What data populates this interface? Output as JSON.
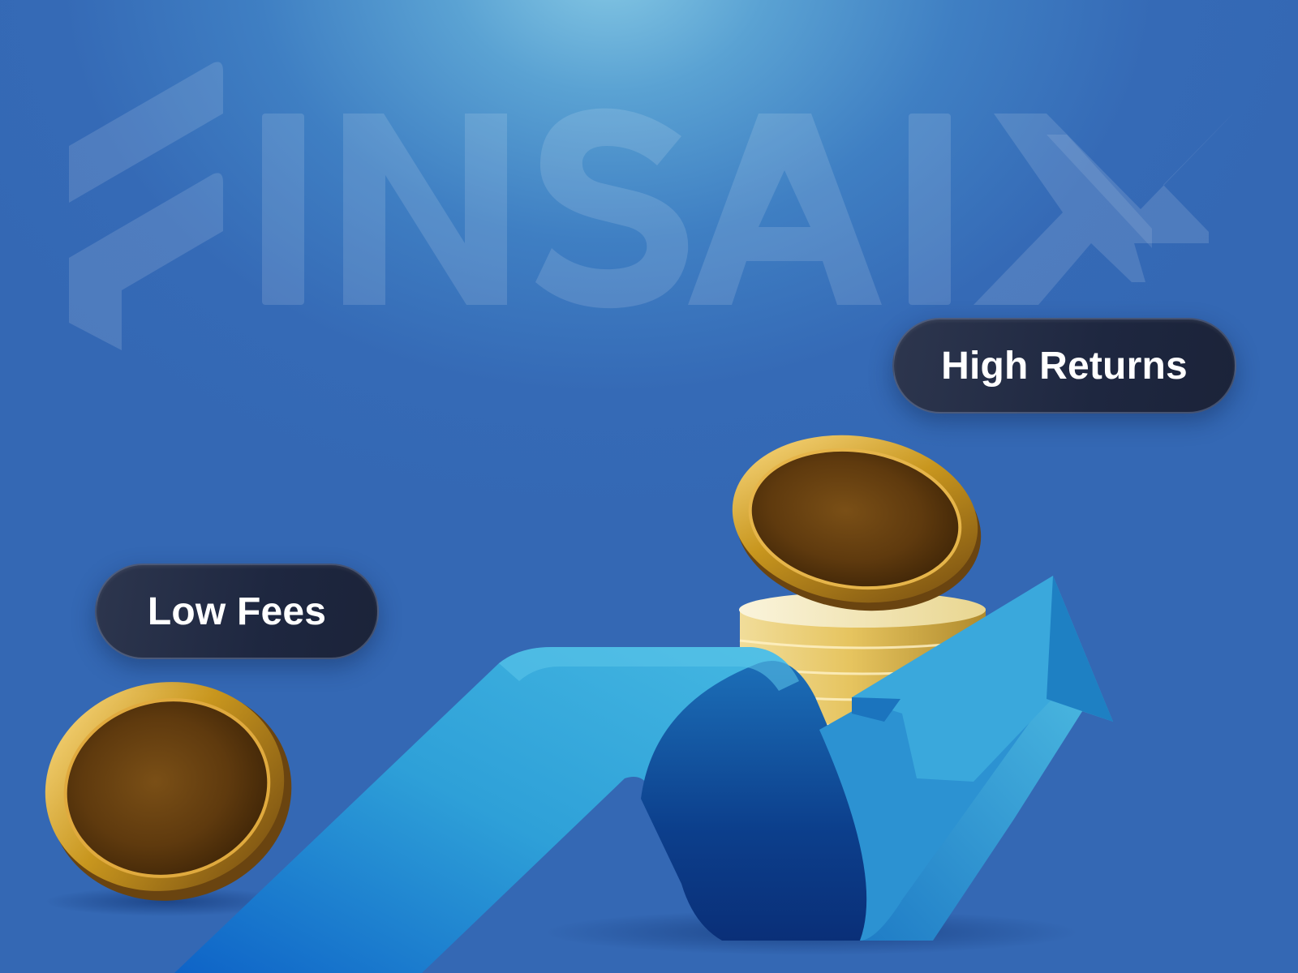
{
  "watermark": {
    "text": "FINSAIX"
  },
  "badges": {
    "high_returns": "High Returns",
    "low_fees": "Low Fees"
  },
  "colors": {
    "background_top": "#85c8e4",
    "background_base": "#3468b4",
    "badge_fill": "#1e2740",
    "arrow_light": "#3cb1dd",
    "arrow_dark": "#0b3f8f",
    "coin_gold": "#c8961e"
  }
}
